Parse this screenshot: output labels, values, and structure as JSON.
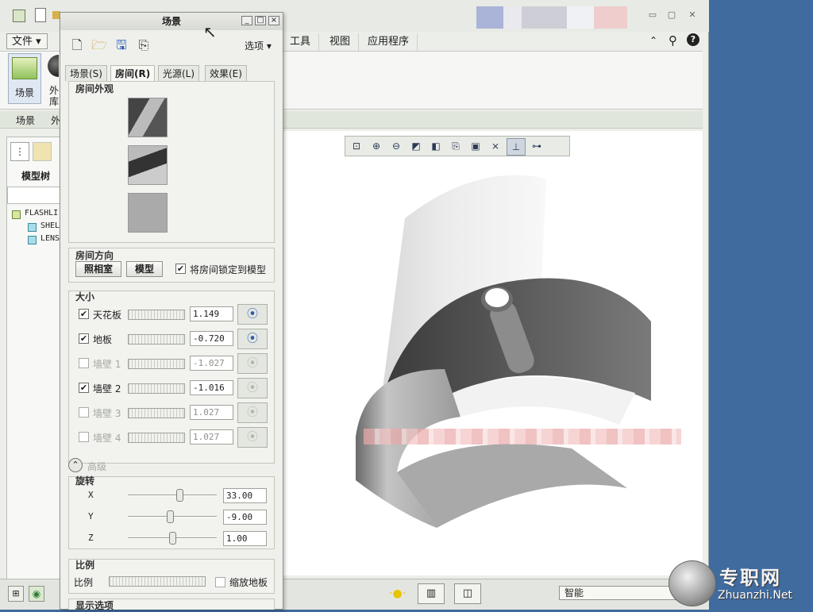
{
  "app": {
    "file_menu": "文件",
    "ribbon_tabs": [
      "工具",
      "视图",
      "应用程序"
    ],
    "ribbon_scene_button": "场景",
    "ribbon_partial_label": "外\n库",
    "ribbon_group_labels": [
      "场景",
      "外"
    ],
    "model_tree_label": "模型树",
    "tree_items": [
      "FLASHLI",
      "SHEL",
      "LENS"
    ],
    "status_combo": "智能",
    "watermark_cn": "专职网",
    "watermark_en": "Zhuanzhi.Net"
  },
  "dialog": {
    "title": "场景",
    "options_label": "选项",
    "tabs": [
      "场景(S)",
      "房间(R)",
      "光源(L)",
      "效果(E)"
    ],
    "selected_tab": "房间(R)",
    "room_appearance_title": "房间外观",
    "room_orientation_title": "房间方向",
    "studio_button": "照相室",
    "model_button": "模型",
    "lock_room_label": "将房间锁定到模型",
    "size_title": "大小",
    "size_rows": [
      {
        "label": "天花板",
        "value": "1.149",
        "checked": true,
        "enabled": true
      },
      {
        "label": "地板",
        "value": "-0.720",
        "checked": true,
        "enabled": true
      },
      {
        "label": "墙壁 1",
        "value": "-1.027",
        "checked": false,
        "enabled": false
      },
      {
        "label": "墙壁 2",
        "value": "-1.016",
        "checked": true,
        "enabled": true
      },
      {
        "label": "墙壁 3",
        "value": "1.027",
        "checked": false,
        "enabled": false
      },
      {
        "label": "墙壁 4",
        "value": "1.027",
        "checked": false,
        "enabled": false
      }
    ],
    "advanced_label": "高级",
    "rotation_title": "旋转",
    "rotation": [
      {
        "axis": "X",
        "value": "33.00"
      },
      {
        "axis": "Y",
        "value": "-9.00"
      },
      {
        "axis": "Z",
        "value": "1.00"
      }
    ],
    "scale_title": "比例",
    "scale_label": "比例",
    "scale_floor_label": "缩放地板",
    "display_options_title": "显示选项"
  },
  "colors": {
    "desktop": "#3f6b9f",
    "accent_blue": "#2a5db0"
  }
}
